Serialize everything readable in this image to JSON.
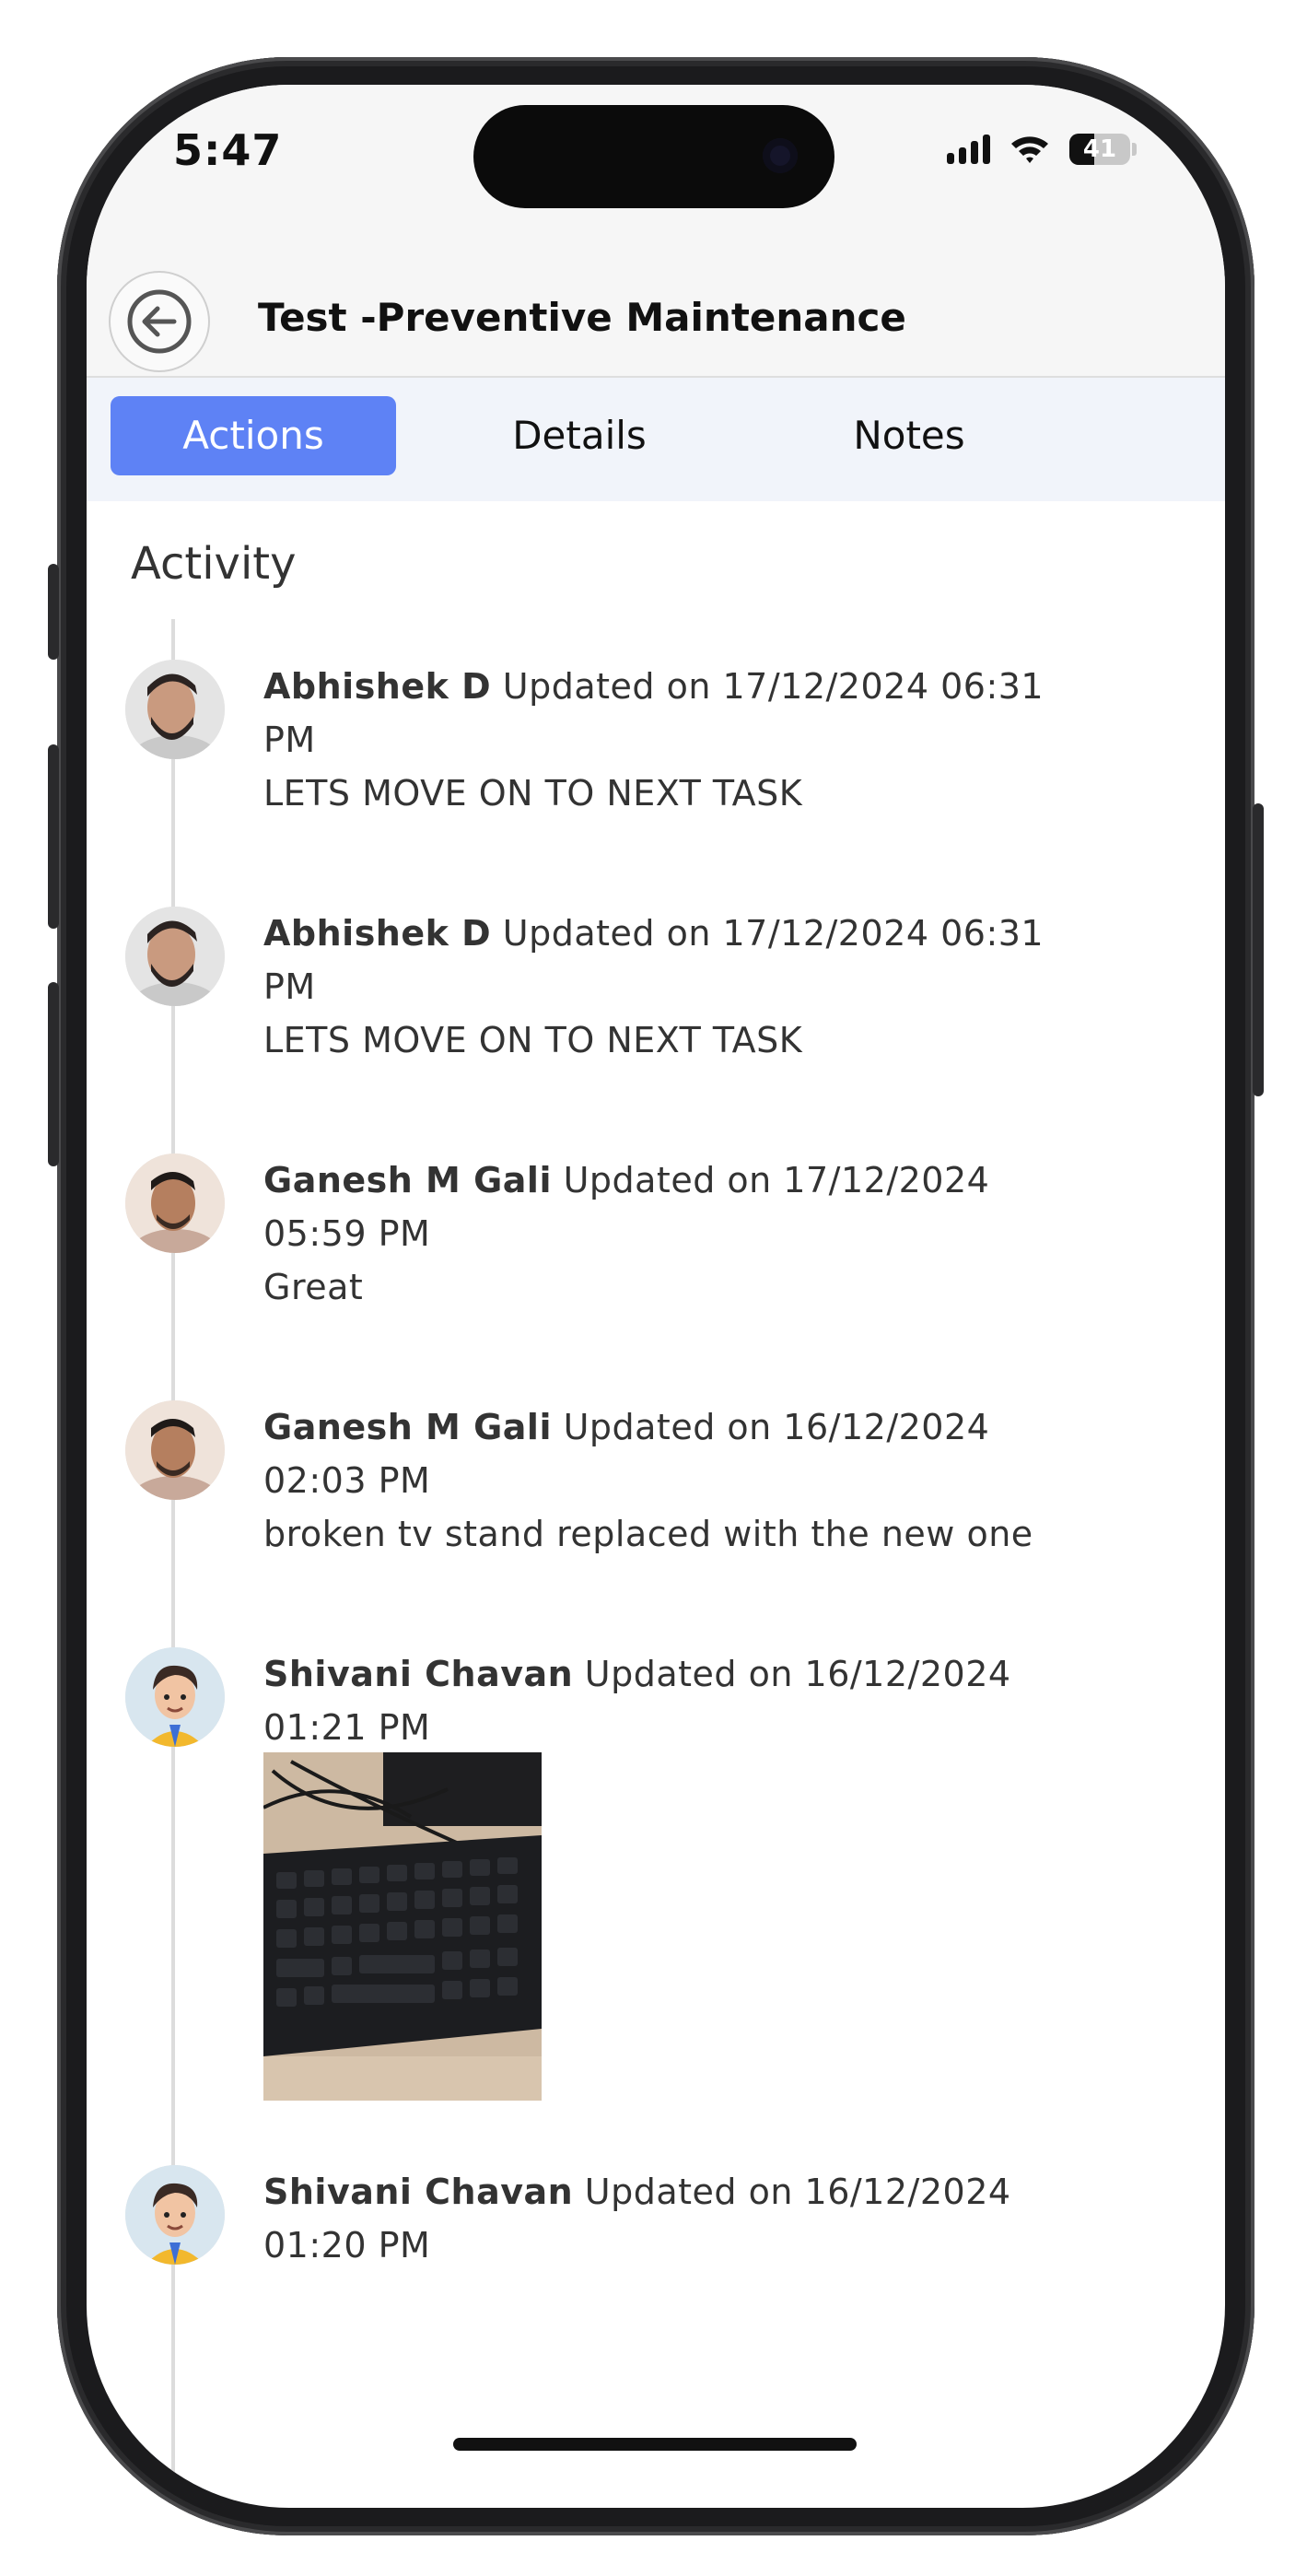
{
  "status_bar": {
    "time": "5:47",
    "battery_percent": "41",
    "battery_level": 0.41
  },
  "header": {
    "title": "Test -Preventive Maintenance"
  },
  "tabs": [
    {
      "label": "Actions",
      "active": true
    },
    {
      "label": "Details",
      "active": false
    },
    {
      "label": "Notes",
      "active": false
    }
  ],
  "activity": {
    "title": "Activity",
    "items": [
      {
        "author": "Abhishek D",
        "line1": " Updated on 17/12/2024 06:31",
        "line2": "PM",
        "message": "LETS MOVE ON TO NEXT TASK",
        "avatar": "photo-avatar"
      },
      {
        "author": "Abhishek D",
        "line1": " Updated on 17/12/2024 06:31",
        "line2": "PM",
        "message": "LETS MOVE ON TO NEXT TASK",
        "avatar": "photo-avatar"
      },
      {
        "author": "Ganesh M Gali",
        "line1": " Updated on 17/12/2024",
        "line2": "05:59 PM",
        "message": "Great",
        "avatar": "photo-avatar"
      },
      {
        "author": "Ganesh M Gali",
        "line1": " Updated on 16/12/2024",
        "line2": "02:03 PM",
        "message": "broken tv stand replaced with the new one",
        "avatar": "photo-avatar"
      },
      {
        "author": "Shivani Chavan",
        "line1": " Updated on 16/12/2024",
        "line2": "01:21 PM",
        "message": "",
        "avatar": "cartoon-avatar",
        "attachment": "keyboard-photo"
      },
      {
        "author": "Shivani Chavan",
        "line1": " Updated on 16/12/2024",
        "line2": "01:20 PM",
        "message": "",
        "avatar": "cartoon-avatar"
      }
    ]
  },
  "colors": {
    "accent": "#5e82f5",
    "tab_bar_bg": "#f1f4fa",
    "header_bg": "#f6f6f6",
    "timeline": "#dcdcdc"
  }
}
